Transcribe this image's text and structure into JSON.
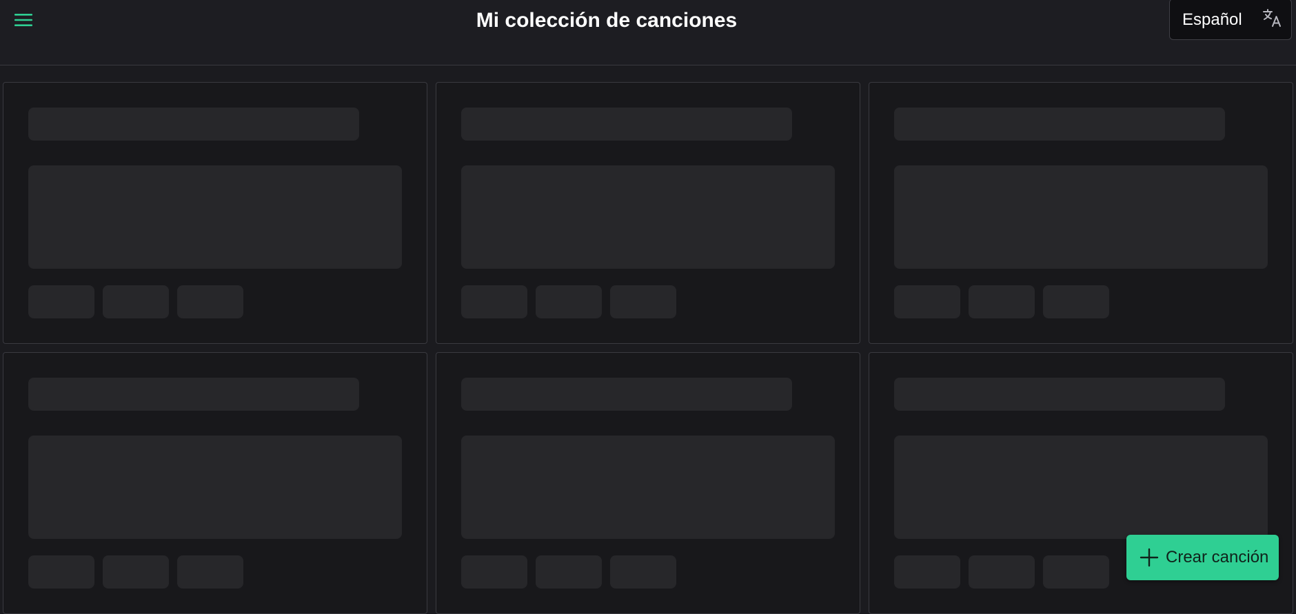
{
  "header": {
    "title": "Mi colección de canciones",
    "menu_icon": "menu-icon",
    "accent_color": "#2fcf93"
  },
  "language": {
    "selected": "Español",
    "icon": "translate-icon"
  },
  "songs": {
    "state": "loading",
    "placeholder_cards": 6
  },
  "fab": {
    "label": "Crear canción",
    "icon": "plus-icon",
    "color": "#2fcf93"
  }
}
